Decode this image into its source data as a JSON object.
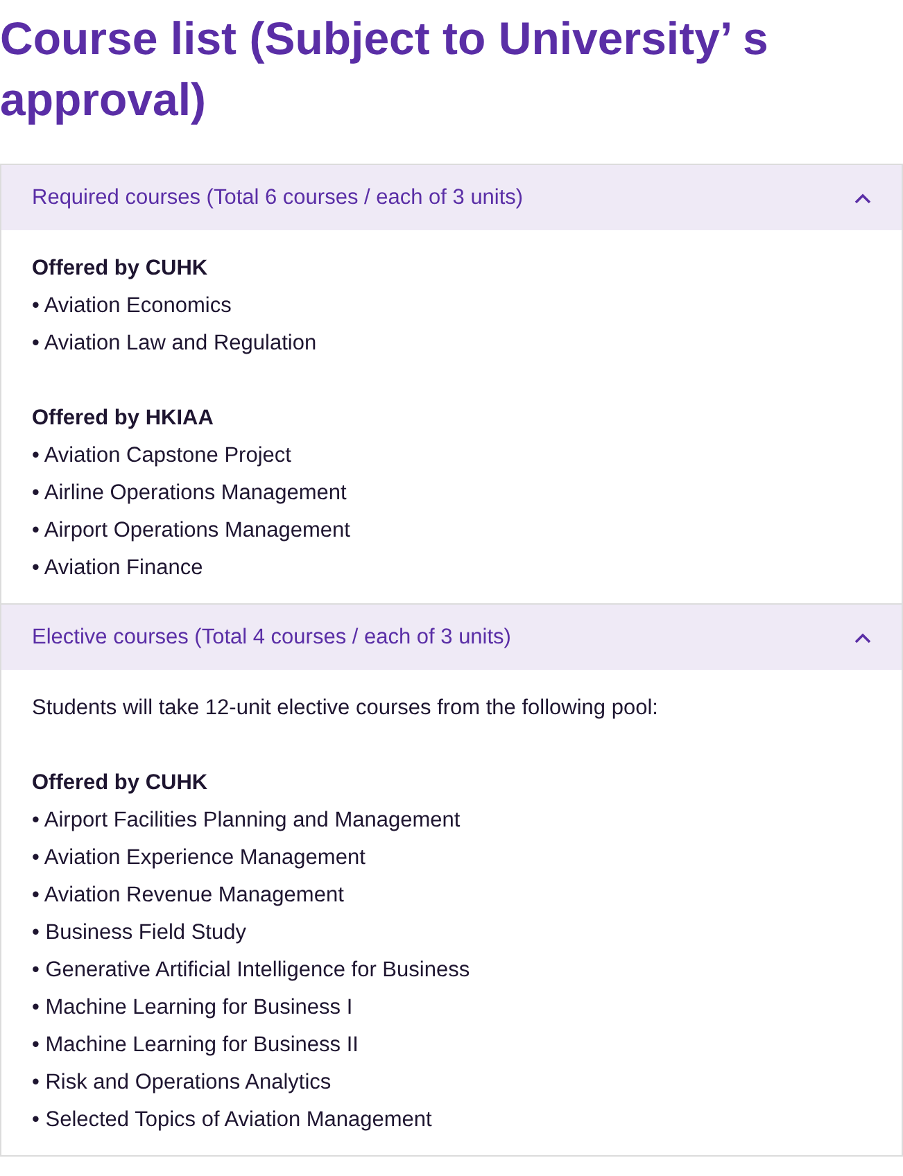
{
  "title": "Course list (Subject to University’ s approval)",
  "sections": [
    {
      "header": "Required courses (Total 6 courses / each of 3 units)",
      "expanded": true,
      "blocks": [
        {
          "kind": "group",
          "heading": "Offered by CUHK",
          "items": [
            "• Aviation Economics",
            "• Aviation Law and Regulation"
          ]
        },
        {
          "kind": "group",
          "heading": "Offered by HKIAA",
          "items": [
            "• Aviation Capstone Project",
            "• Airline Operations Management",
            "• Airport Operations Management",
            "• Aviation Finance"
          ]
        }
      ]
    },
    {
      "header": "Elective courses (Total 4 courses / each of 3 units)",
      "expanded": true,
      "blocks": [
        {
          "kind": "paragraph",
          "text": "Students will take 12-unit elective courses from the following pool:"
        },
        {
          "kind": "group",
          "heading": "Offered by CUHK",
          "items": [
            "• Airport Facilities Planning and Management",
            "• Aviation Experience Management",
            "• Aviation Revenue Management",
            "• Business Field Study",
            "• Generative Artificial Intelligence for Business",
            "• Machine Learning for Business I",
            "• Machine Learning for Business II",
            "• Risk and Operations Analytics",
            "• Selected Topics of Aviation Management"
          ]
        }
      ]
    }
  ]
}
